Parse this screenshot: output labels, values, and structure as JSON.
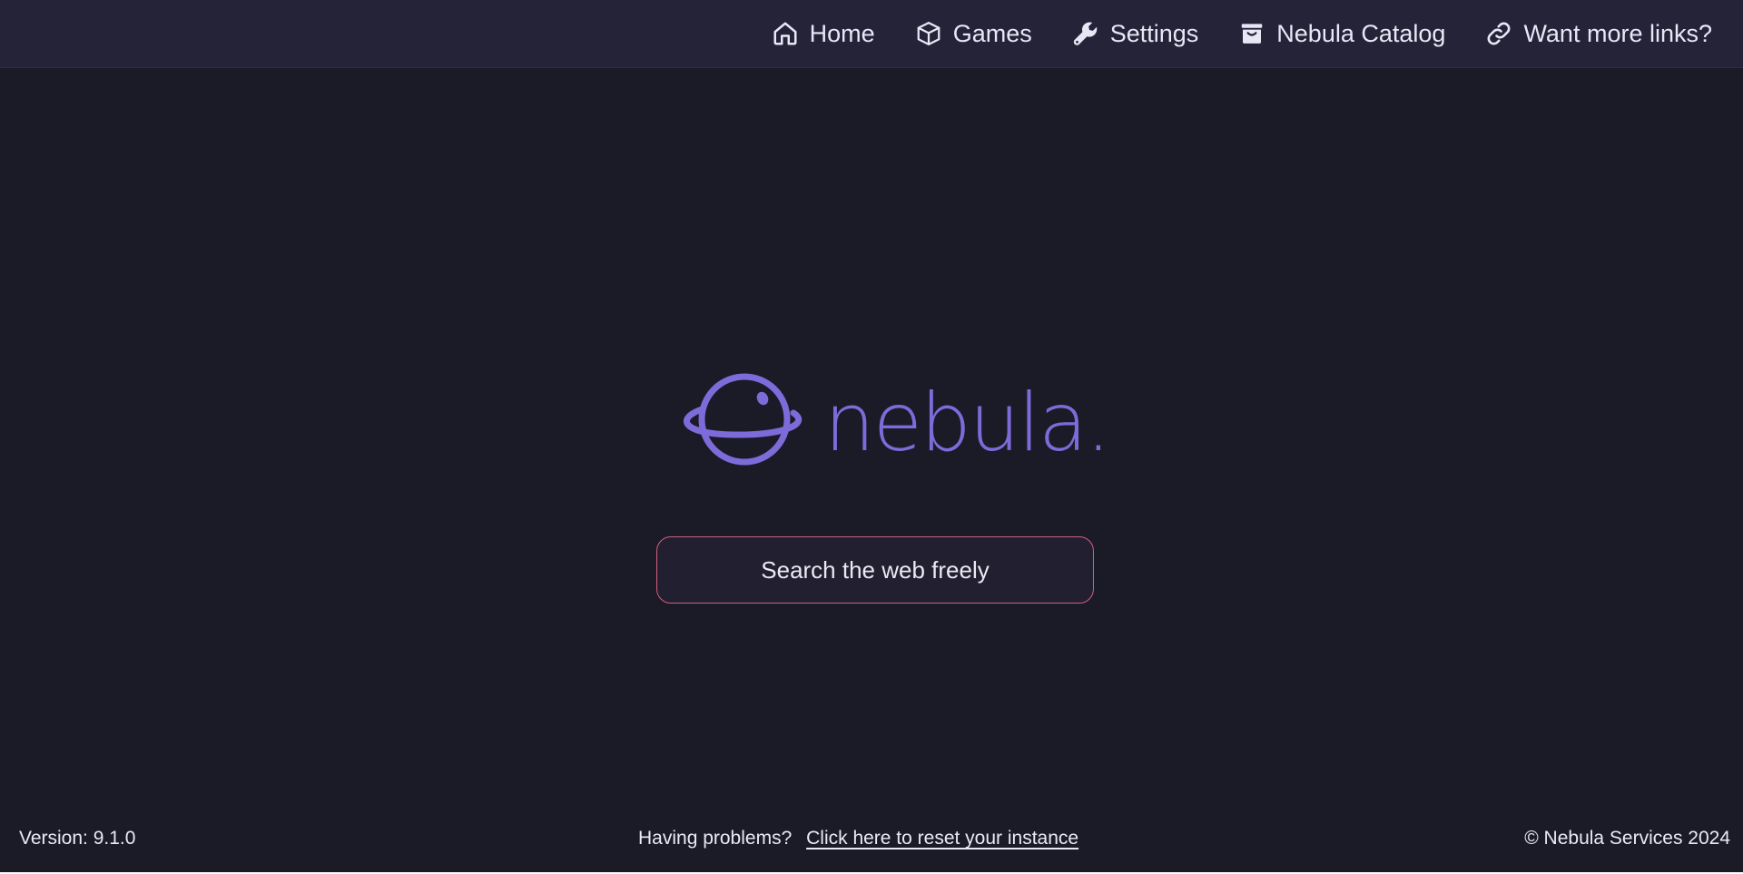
{
  "nav": {
    "items": [
      {
        "label": "Home",
        "icon": "home-icon"
      },
      {
        "label": "Games",
        "icon": "cube-icon"
      },
      {
        "label": "Settings",
        "icon": "wrench-icon"
      },
      {
        "label": "Nebula Catalog",
        "icon": "catalog-box-icon"
      },
      {
        "label": "Want more links?",
        "icon": "link-icon"
      }
    ]
  },
  "logo": {
    "wordmark": "nebula.",
    "color": "#7d6bd9"
  },
  "search": {
    "placeholder": "Search the web freely",
    "border_color": "#d1607d"
  },
  "footer": {
    "version": "Version: 9.1.0",
    "help_text": "Having problems?",
    "reset_link": "Click here to reset your instance",
    "copyright": "© Nebula Services 2024"
  },
  "colors": {
    "background": "#1b1a27",
    "topbar": "#242338",
    "text": "#e9e7f5"
  }
}
